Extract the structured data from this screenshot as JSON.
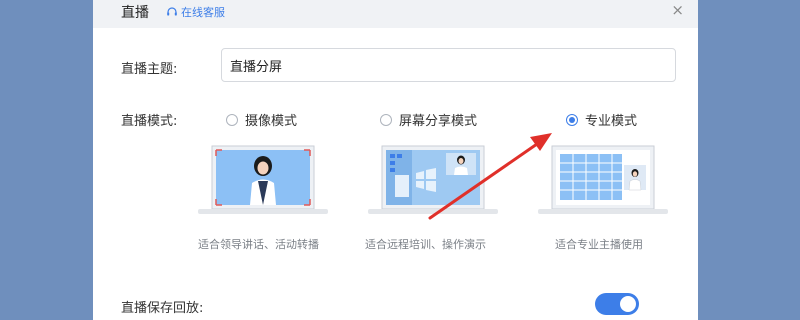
{
  "header": {
    "title": "直播",
    "service_label": "在线客服",
    "close_glyph": "×"
  },
  "form": {
    "topic_label": "直播主题:",
    "topic_value": "直播分屏",
    "mode_label": "直播模式:",
    "save_replay_label": "直播保存回放:",
    "save_replay_enabled": true
  },
  "modes": [
    {
      "label": "摄像模式",
      "caption": "适合领导讲话、活动转播",
      "selected": false
    },
    {
      "label": "屏幕分享模式",
      "caption": "适合远程培训、操作演示",
      "selected": false
    },
    {
      "label": "专业模式",
      "caption": "适合专业主播使用",
      "selected": true
    }
  ],
  "colors": {
    "accent": "#3d7ee8",
    "annotation_arrow": "#e0302a",
    "page_background": "#6f8fbd"
  },
  "icons": {
    "service": "headset-icon",
    "close": "close-icon"
  }
}
